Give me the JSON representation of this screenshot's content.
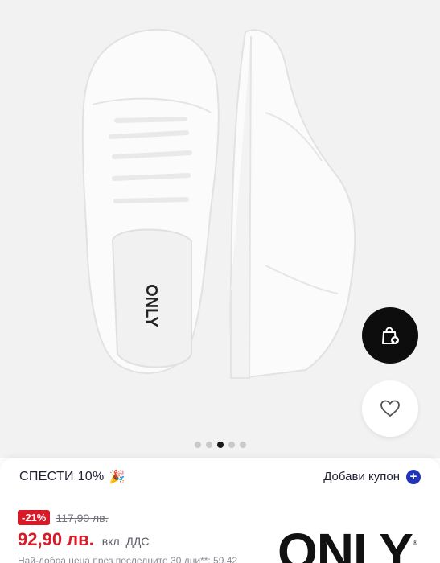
{
  "gallery": {
    "product_name_on_insole": "ONLY",
    "carousel": {
      "count": 5,
      "active_index": 2
    }
  },
  "icons": {
    "add_to_bag": "bag-plus-icon",
    "wishlist": "heart-icon",
    "coupon_add": "plus-circle-icon",
    "promo": "party-popper-icon"
  },
  "promo": {
    "text": "СПЕСТИ 10%",
    "emoji": "🎉",
    "coupon_label": "Добави купон"
  },
  "pricing": {
    "discount": "-21%",
    "old_price": "117,90 лв.",
    "price": "92,90 лв.",
    "vat_note": "вкл. ДДС",
    "lowest_price_note": "Най-добра цена през последните 30 дни**: 59,42"
  },
  "brand": {
    "logo": "ONLY",
    "reg": "®"
  },
  "colors": {
    "sale_red": "#d81927",
    "accent_blue": "#2133b8",
    "fab_dark": "#0d0d0d",
    "gallery_bg": "#f2f2f3"
  }
}
